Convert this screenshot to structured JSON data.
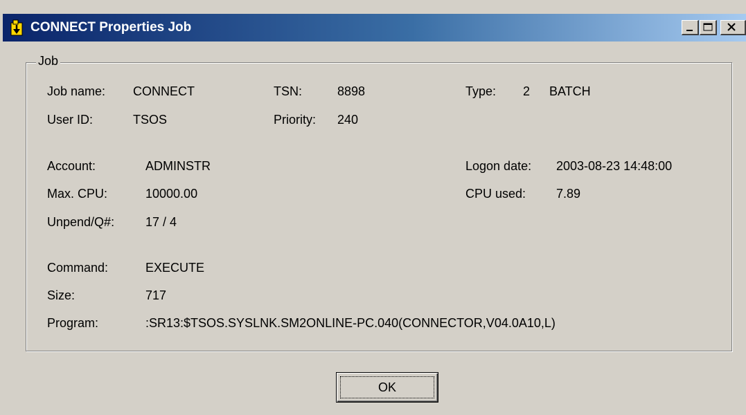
{
  "window": {
    "title": "CONNECT Properties Job",
    "icon": "job-app-icon",
    "controls": [
      "minimize-icon",
      "maximize-icon",
      "close-icon"
    ],
    "accent": "#0a246a",
    "face_color": "#d4d0c8"
  },
  "group": {
    "label": "Job"
  },
  "fields": {
    "job_name": {
      "label": "Job name:",
      "value": "CONNECT"
    },
    "tsn": {
      "label": "TSN:",
      "value": "8898"
    },
    "type": {
      "label": "Type:",
      "value_num": "2",
      "value_text": "BATCH"
    },
    "user_id": {
      "label": "User ID:",
      "value": "TSOS"
    },
    "priority": {
      "label": "Priority:",
      "value": "240"
    },
    "account": {
      "label": "Account:",
      "value": "ADMINSTR"
    },
    "logon_date": {
      "label": "Logon date:",
      "value": "2003-08-23 14:48:00"
    },
    "max_cpu": {
      "label": "Max. CPU:",
      "value": "10000.00"
    },
    "cpu_used": {
      "label": "CPU used:",
      "value": "7.89"
    },
    "unpend_q": {
      "label": "Unpend/Q#:",
      "value": "17 / 4"
    },
    "command": {
      "label": "Command:",
      "value": "EXECUTE"
    },
    "size": {
      "label": "Size:",
      "value": "717"
    },
    "program": {
      "label": "Program:",
      "value": ":SR13:$TSOS.SYSLNK.SM2ONLINE-PC.040(CONNECTOR,V04.0A10,L)"
    }
  },
  "buttons": {
    "ok_label": "OK"
  }
}
